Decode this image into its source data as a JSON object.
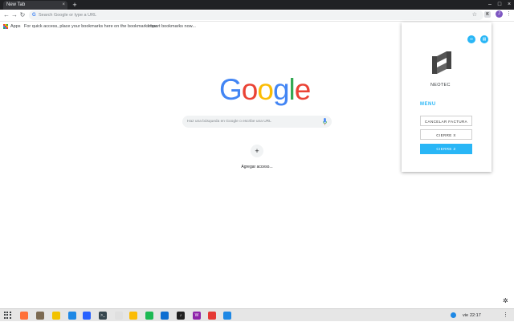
{
  "browser": {
    "tab_title": "New Tab",
    "tab_close": "×",
    "new_tab": "+",
    "window_controls": [
      "–",
      "□",
      "×"
    ],
    "nav": {
      "back": "←",
      "forward": "→",
      "reload": "↻"
    },
    "omnibox_g": "G",
    "omnibox_placeholder": "Search Google or type a URL",
    "star": "☆",
    "extension_letter": "K",
    "profile_letter": "J",
    "menu": "⋮"
  },
  "bookmarks": {
    "apps_label": "Apps",
    "hint": "For quick access, place your bookmarks here on the bookmarks bar.",
    "import_link": "Import bookmarks now...",
    "apps_colors": [
      "#ea4335",
      "#fbbc05",
      "#34a853",
      "#4285f4",
      "#ea4335",
      "#fbbc05",
      "#34a853",
      "#4285f4",
      "#ea4335"
    ]
  },
  "google": {
    "logo_letters": [
      {
        "ch": "G",
        "color": "#4285f4"
      },
      {
        "ch": "o",
        "color": "#ea4335"
      },
      {
        "ch": "o",
        "color": "#fbbc05"
      },
      {
        "ch": "g",
        "color": "#4285f4"
      },
      {
        "ch": "l",
        "color": "#34a853"
      },
      {
        "ch": "e",
        "color": "#ea4335"
      }
    ],
    "search_placeholder": "Haz una búsqueda en Google o escribe una URL",
    "shortcut_plus": "+",
    "shortcut_label": "Agregar acceso..."
  },
  "popup": {
    "top_icons": [
      "∞",
      "▤"
    ],
    "brand": "NEOTEC",
    "menu_title": "MENU",
    "buttons": [
      "CANCELAR FACTURA",
      "CIERRE X",
      "CIERRE Z"
    ],
    "accent": "#29b6f6"
  },
  "page_gear": "✲",
  "taskbar": {
    "apps": [
      {
        "name": "firefox",
        "letter": "",
        "color": "#ff7139"
      },
      {
        "name": "files",
        "letter": "",
        "color": "#7c6a52"
      },
      {
        "name": "notes",
        "letter": "",
        "color": "#f2c200"
      },
      {
        "name": "store",
        "letter": "",
        "color": "#1e88e5"
      },
      {
        "name": "vscode",
        "letter": "",
        "color": "#2962ff"
      },
      {
        "name": "terminal",
        "letter": ">_",
        "color": "#37474f"
      },
      {
        "name": "sketch",
        "letter": "",
        "color": "#e0e0e0"
      },
      {
        "name": "chrome",
        "letter": "",
        "color": "#fbbc05"
      },
      {
        "name": "spotify",
        "letter": "",
        "color": "#1db954"
      },
      {
        "name": "teamviewer",
        "letter": "",
        "color": "#0e6ed1"
      },
      {
        "name": "music",
        "letter": "♪",
        "color": "#212121"
      },
      {
        "name": "webstorm",
        "letter": "W",
        "color": "#8e24aa"
      },
      {
        "name": "media",
        "letter": "",
        "color": "#e53935"
      },
      {
        "name": "app",
        "letter": "",
        "color": "#1e88e5"
      }
    ],
    "day": "vie",
    "time": "22:17",
    "more": "⋮"
  }
}
